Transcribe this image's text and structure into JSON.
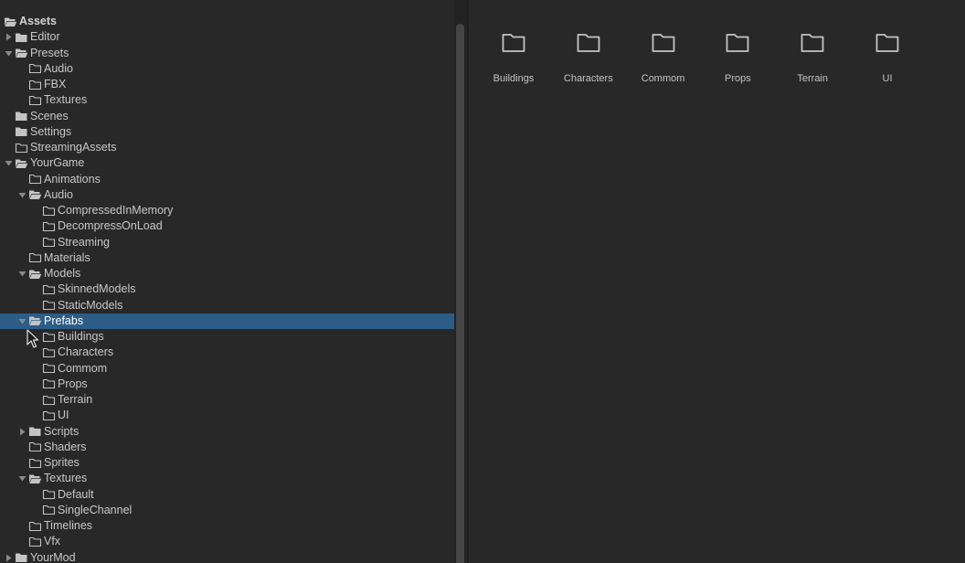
{
  "tree": {
    "rows": [
      {
        "label": "Assets",
        "depth": 0,
        "arrow": "none",
        "folder": "open-filled",
        "root": true
      },
      {
        "label": "Editor",
        "depth": 0,
        "arrow": "right",
        "folder": "filled"
      },
      {
        "label": "Presets",
        "depth": 0,
        "arrow": "down",
        "folder": "open-filled"
      },
      {
        "label": "Audio",
        "depth": 1,
        "arrow": "none",
        "folder": "outline"
      },
      {
        "label": "FBX",
        "depth": 1,
        "arrow": "none",
        "folder": "outline"
      },
      {
        "label": "Textures",
        "depth": 1,
        "arrow": "none",
        "folder": "outline"
      },
      {
        "label": "Scenes",
        "depth": 0,
        "arrow": "none",
        "folder": "filled"
      },
      {
        "label": "Settings",
        "depth": 0,
        "arrow": "none",
        "folder": "filled"
      },
      {
        "label": "StreamingAssets",
        "depth": 0,
        "arrow": "none",
        "folder": "outline"
      },
      {
        "label": "YourGame",
        "depth": 0,
        "arrow": "down",
        "folder": "open-filled"
      },
      {
        "label": "Animations",
        "depth": 1,
        "arrow": "none",
        "folder": "outline"
      },
      {
        "label": "Audio",
        "depth": 1,
        "arrow": "down",
        "folder": "open-filled"
      },
      {
        "label": "CompressedInMemory",
        "depth": 2,
        "arrow": "none",
        "folder": "outline"
      },
      {
        "label": "DecompressOnLoad",
        "depth": 2,
        "arrow": "none",
        "folder": "outline"
      },
      {
        "label": "Streaming",
        "depth": 2,
        "arrow": "none",
        "folder": "outline"
      },
      {
        "label": "Materials",
        "depth": 1,
        "arrow": "none",
        "folder": "outline"
      },
      {
        "label": "Models",
        "depth": 1,
        "arrow": "down",
        "folder": "open-filled"
      },
      {
        "label": "SkinnedModels",
        "depth": 2,
        "arrow": "none",
        "folder": "outline"
      },
      {
        "label": "StaticModels",
        "depth": 2,
        "arrow": "none",
        "folder": "outline"
      },
      {
        "label": "Prefabs",
        "depth": 1,
        "arrow": "down",
        "folder": "open-filled",
        "selected": true
      },
      {
        "label": "Buildings",
        "depth": 2,
        "arrow": "none",
        "folder": "outline"
      },
      {
        "label": "Characters",
        "depth": 2,
        "arrow": "none",
        "folder": "outline"
      },
      {
        "label": "Commom",
        "depth": 2,
        "arrow": "none",
        "folder": "outline"
      },
      {
        "label": "Props",
        "depth": 2,
        "arrow": "none",
        "folder": "outline"
      },
      {
        "label": "Terrain",
        "depth": 2,
        "arrow": "none",
        "folder": "outline"
      },
      {
        "label": "UI",
        "depth": 2,
        "arrow": "none",
        "folder": "outline"
      },
      {
        "label": "Scripts",
        "depth": 1,
        "arrow": "right",
        "folder": "filled"
      },
      {
        "label": "Shaders",
        "depth": 1,
        "arrow": "none",
        "folder": "outline"
      },
      {
        "label": "Sprites",
        "depth": 1,
        "arrow": "none",
        "folder": "outline"
      },
      {
        "label": "Textures",
        "depth": 1,
        "arrow": "down",
        "folder": "open-filled"
      },
      {
        "label": "Default",
        "depth": 2,
        "arrow": "none",
        "folder": "outline"
      },
      {
        "label": "SingleChannel",
        "depth": 2,
        "arrow": "none",
        "folder": "outline"
      },
      {
        "label": "Timelines",
        "depth": 1,
        "arrow": "none",
        "folder": "outline"
      },
      {
        "label": "Vfx",
        "depth": 1,
        "arrow": "none",
        "folder": "outline"
      },
      {
        "label": "YourMod",
        "depth": 0,
        "arrow": "right",
        "folder": "filled"
      }
    ]
  },
  "grid": {
    "items": [
      {
        "label": "Buildings",
        "icon": "folder-icon"
      },
      {
        "label": "Characters",
        "icon": "folder-icon"
      },
      {
        "label": "Commom",
        "icon": "folder-icon"
      },
      {
        "label": "Props",
        "icon": "folder-icon"
      },
      {
        "label": "Terrain",
        "icon": "folder-icon"
      },
      {
        "label": "UI",
        "icon": "folder-icon"
      }
    ]
  },
  "colors": {
    "background": "#282828",
    "selection": "#2c5d87",
    "text": "#c8c8c8",
    "icon": "#c4c4c4"
  }
}
